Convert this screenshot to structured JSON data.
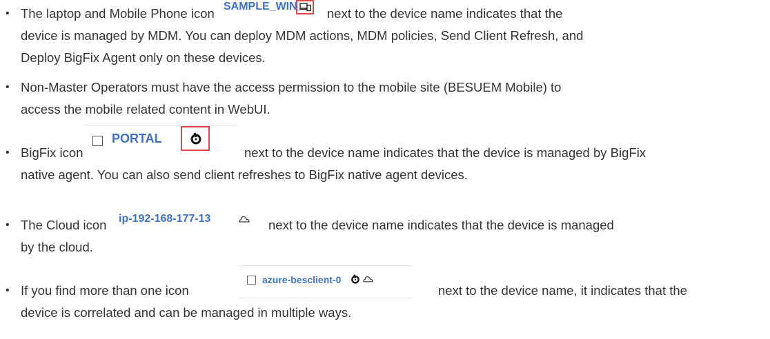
{
  "items": [
    {
      "lines": [
        "The laptop and Mobile Phone icon",
        "next to the device name indicates that the",
        "device is managed by MDM. You can deploy MDM actions, MDM policies, Send Client Refresh, and",
        "Deploy BigFix Agent only on these devices."
      ],
      "device_name": "SAMPLE_WIN",
      "icon": "laptop-mobile-icon"
    },
    {
      "lines": [
        "Non-Master Operators must have the access permission to the mobile site (BESUEM Mobile) to",
        "access the mobile related content in WebUI."
      ]
    },
    {
      "lines": [
        "BigFix icon",
        "next to the device name indicates that the device is managed by BigFix",
        "native agent. You can also send client refreshes to BigFix native agent devices."
      ],
      "device_name": "PORTAL",
      "icon": "bigfix-icon"
    },
    {
      "lines": [
        "The Cloud icon",
        "next to the device name indicates that the device is managed",
        "by the cloud."
      ],
      "device_name": "ip-192-168-177-13",
      "icon": "cloud-icon"
    },
    {
      "lines": [
        "If you find more than one icon",
        "next to the device name, it indicates that the",
        "device is correlated and can be managed in multiple ways."
      ],
      "device_name": "azure-besclient-0",
      "icons": [
        "bigfix-icon",
        "cloud-icon"
      ]
    }
  ],
  "colors": {
    "text": "#333333",
    "device_link": "#3d72c4",
    "highlight_box": "#e0464c"
  }
}
